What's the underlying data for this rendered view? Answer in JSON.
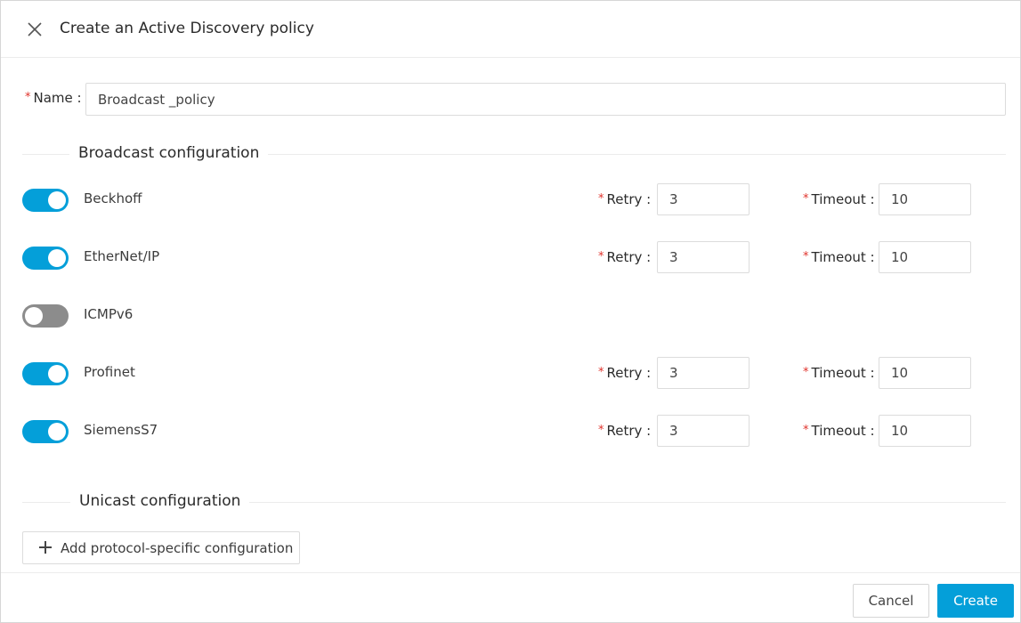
{
  "header": {
    "title": "Create an Active Discovery policy"
  },
  "name_field": {
    "required_mark": "*",
    "label": "Name :",
    "value": "Broadcast _policy"
  },
  "broadcast": {
    "title": "Broadcast configuration",
    "retry_label": "Retry :",
    "timeout_label": "Timeout :",
    "required_mark": "*",
    "protocols": [
      {
        "name": "Beckhoff",
        "enabled": true,
        "retry": "3",
        "timeout": "10"
      },
      {
        "name": "EtherNet/IP",
        "enabled": true,
        "retry": "3",
        "timeout": "10"
      },
      {
        "name": "ICMPv6",
        "enabled": false
      },
      {
        "name": "Profinet",
        "enabled": true,
        "retry": "3",
        "timeout": "10"
      },
      {
        "name": "SiemensS7",
        "enabled": true,
        "retry": "3",
        "timeout": "10"
      }
    ]
  },
  "unicast": {
    "title": "Unicast configuration",
    "add_button_label": "Add protocol-specific configuration"
  },
  "footer": {
    "cancel_label": "Cancel",
    "create_label": "Create"
  },
  "colors": {
    "accent": "#049fd9",
    "toggle_off": "#8c8c8c",
    "required": "#e0322b"
  }
}
